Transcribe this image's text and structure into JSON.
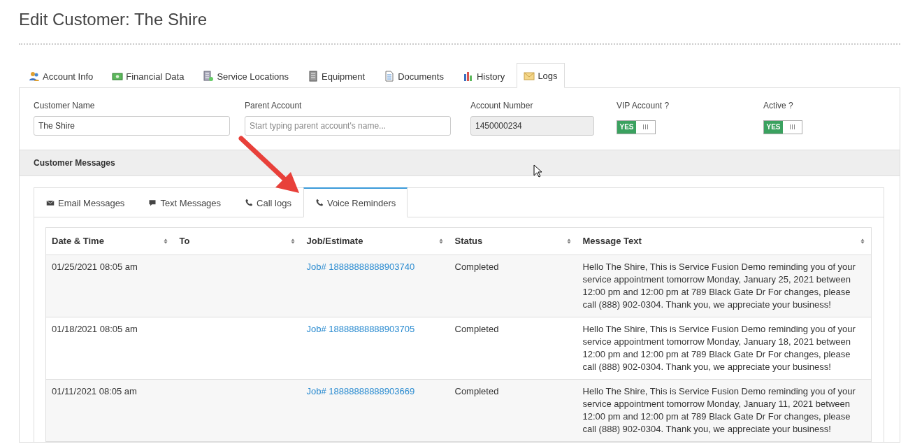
{
  "page_title": "Edit Customer: The Shire",
  "tabs": [
    {
      "label": "Account Info",
      "selected": false
    },
    {
      "label": "Financial Data",
      "selected": false
    },
    {
      "label": "Service Locations",
      "selected": false
    },
    {
      "label": "Equipment",
      "selected": false
    },
    {
      "label": "Documents",
      "selected": false
    },
    {
      "label": "History",
      "selected": false
    },
    {
      "label": "Logs",
      "selected": true
    }
  ],
  "fields": [
    {
      "label": "Customer Name",
      "value": "The Shire",
      "disabled": false
    },
    {
      "label": "Parent Account",
      "placeholder": "Start typing parent account's name...",
      "disabled": false
    },
    {
      "label": "Account Number",
      "value": "1450000234",
      "disabled": true
    }
  ],
  "toggles": [
    {
      "label": "VIP Account ?",
      "on": true,
      "text": "YES"
    },
    {
      "label": "Active ?",
      "on": true,
      "text": "YES"
    }
  ],
  "section_title": "Customer Messages",
  "message_tabs": [
    {
      "label": "Email Messages",
      "selected": false
    },
    {
      "label": "Text Messages",
      "selected": false
    },
    {
      "label": "Call logs",
      "selected": false
    },
    {
      "label": "Voice Reminders",
      "selected": true
    }
  ],
  "table": {
    "columns": [
      "Date & Time",
      "To",
      "Job/Estimate",
      "Status",
      "Message Text"
    ],
    "rows": [
      {
        "date": "01/25/2021 08:05 am",
        "job": "Job# 18888888888903740",
        "status": "Completed",
        "message": "Hello The Shire, This is Service Fusion Demo reminding you of your service appointment tomorrow Monday, January 25, 2021 between 12:00 pm and 12:00 pm at 789 Black Gate Dr For changes, please call (888) 902-0304. Thank you, we appreciate your business!"
      },
      {
        "date": "01/18/2021 08:05 am",
        "job": "Job# 18888888888903705",
        "status": "Completed",
        "message": "Hello The Shire, This is Service Fusion Demo reminding you of your service appointment tomorrow Monday, January 18, 2021 between 12:00 pm and 12:00 pm at 789 Black Gate Dr For changes, please call (888) 902-0304. Thank you, we appreciate your business!"
      },
      {
        "date": "01/11/2021 08:05 am",
        "job": "Job# 18888888888903669",
        "status": "Completed",
        "message": "Hello The Shire, This is Service Fusion Demo reminding you of your service appointment tomorrow Monday, January 11, 2021 between 12:00 pm and 12:00 pm at 789 Black Gate Dr For changes, please call (888) 902-0304. Thank you, we appreciate your business!"
      }
    ]
  }
}
